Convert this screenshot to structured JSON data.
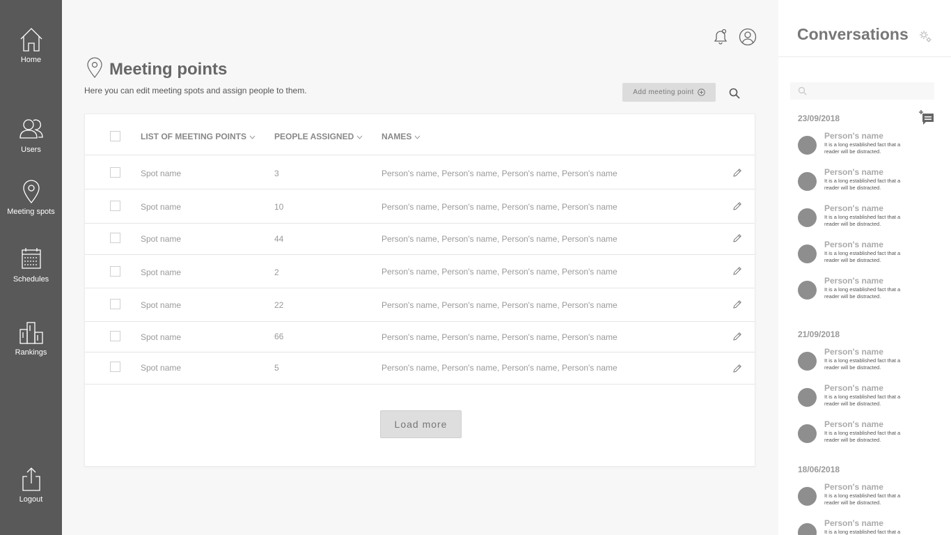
{
  "sidebar": {
    "items": [
      {
        "label": "Home",
        "icon": "home-icon"
      },
      {
        "label": "Users",
        "icon": "users-icon"
      },
      {
        "label": "Meeting spots",
        "icon": "location-pin-icon"
      },
      {
        "label": "Schedules",
        "icon": "calendar-icon"
      },
      {
        "label": "Rankings",
        "icon": "podium-icon"
      }
    ],
    "logout_label": "Logout",
    "background": "#595959"
  },
  "header": {
    "title": "Meeting points",
    "subtitle": "Here you can edit meeting spots and assign people to them.",
    "add_button_label": "Add meeting point"
  },
  "table": {
    "columns": [
      "LIST OF MEETING POINTS",
      "PEOPLE ASSIGNED",
      "NAMES"
    ],
    "rows": [
      {
        "spot": "Spot name",
        "count": "3",
        "names": "Person's name, Person's name, Person's name, Person's name"
      },
      {
        "spot": "Spot name",
        "count": "10",
        "names": "Person's name, Person's name, Person's name, Person's name"
      },
      {
        "spot": "Spot name",
        "count": "44",
        "names": "Person's name, Person's name, Person's name, Person's name"
      },
      {
        "spot": "Spot name",
        "count": "2",
        "names": "Person's name, Person's name, Person's name, Person's name"
      },
      {
        "spot": "Spot name",
        "count": "22",
        "names": "Person's name, Person's name, Person's name, Person's name"
      },
      {
        "spot": "Spot name",
        "count": "66",
        "names": "Person's name, Person's name, Person's name, Person's name"
      },
      {
        "spot": "Spot name",
        "count": "5",
        "names": "Person's name, Person's name, Person's name, Person's name"
      }
    ],
    "load_more_label": "Load more"
  },
  "conversations": {
    "title": "Conversations",
    "search_placeholder": "",
    "groups": [
      {
        "date": "23/09/2018",
        "messages": [
          {
            "name": "Person's name",
            "text": "It is a long established fact that a reader will be distracted."
          },
          {
            "name": "Person's name",
            "text": "It is a long established fact that a reader will be distracted."
          },
          {
            "name": "Person's name",
            "text": "It is a long established fact that a reader will be distracted."
          },
          {
            "name": "Person's name",
            "text": "It is a long established fact that a reader will be distracted."
          },
          {
            "name": "Person's name",
            "text": "It is a long established fact that a reader will be distracted."
          }
        ]
      },
      {
        "date": "21/09/2018",
        "messages": [
          {
            "name": "Person's name",
            "text": "It is a long established fact that a reader will be distracted."
          },
          {
            "name": "Person's name",
            "text": "It is a long established fact that a reader will be distracted."
          },
          {
            "name": "Person's name",
            "text": "It is a long established fact that a reader will be distracted."
          }
        ]
      },
      {
        "date": "18/06/2018",
        "messages": [
          {
            "name": "Person's name",
            "text": "It is a long established fact that a reader will be distracted."
          },
          {
            "name": "Person's name",
            "text": "It is a long established fact that a reader will be distracted."
          }
        ]
      }
    ]
  }
}
